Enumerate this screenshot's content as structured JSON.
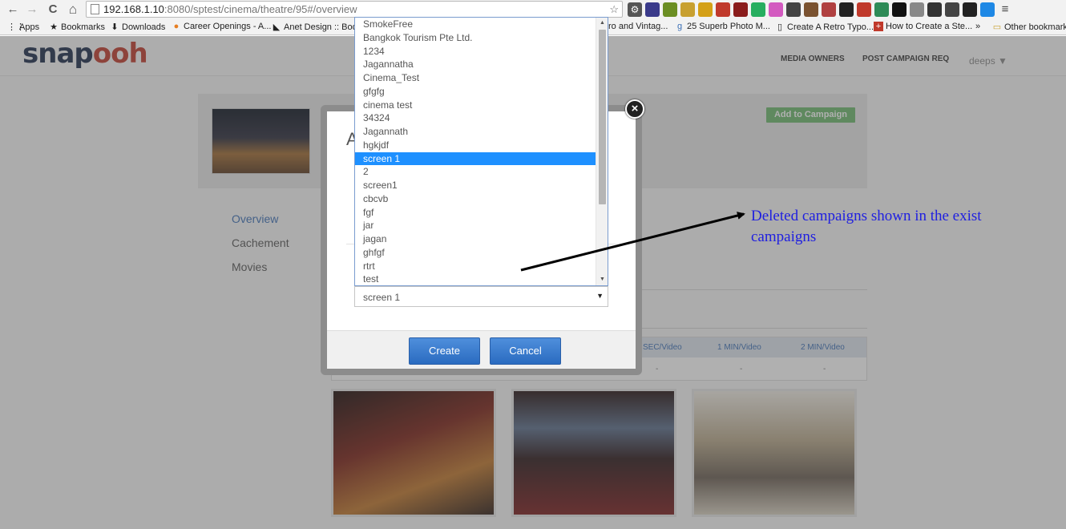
{
  "browser": {
    "url_host": "192.168.1.10",
    "url_rest": ":8080/sptest/cinema/theatre/95#/overview",
    "nav": {
      "back_icon": "←",
      "forward_icon": "→",
      "reload_icon": "C",
      "home_icon": "⌂"
    },
    "bookmarks": [
      {
        "label": "Apps",
        "icon": "apps-icon"
      },
      {
        "label": "Bookmarks",
        "icon": "star-icon"
      },
      {
        "label": "Downloads",
        "icon": "download-icon"
      },
      {
        "label": "Career Openings - A...",
        "icon": "page-icon"
      },
      {
        "label": "Anet Design :: Body",
        "icon": "page-icon"
      },
      {
        "label": "ro and Vintag...",
        "icon": "page-icon"
      },
      {
        "label": "25 Superb Photo M...",
        "icon": "page-icon"
      },
      {
        "label": "Create A Retro Typo...",
        "icon": "page-icon"
      },
      {
        "label": "How to Create a Ste...",
        "icon": "page-icon"
      },
      {
        "label": "»",
        "icon": ""
      },
      {
        "label": "Other bookmarks",
        "icon": "folder-icon"
      }
    ]
  },
  "site": {
    "logo": {
      "main": "snap",
      "accent": "ooh"
    },
    "nav": {
      "media_owners": "MEDIA OWNERS",
      "post_campaign": "POST CAMPAIGN REQ"
    },
    "user": "deeps ▼",
    "add_to_campaign": "Add to Campaign",
    "side_nav": {
      "overview": "Overview",
      "cachement": "Cachement",
      "movies": "Movies"
    },
    "rates": {
      "headers": [
        "SEC/Video",
        "1 MIN/Video",
        "2 MIN/Video"
      ],
      "values": [
        "-",
        "-",
        "-"
      ]
    }
  },
  "modal": {
    "title": "A",
    "select": {
      "selected": "screen 1",
      "options": [
        "SmokeFree",
        "Bangkok Tourism Pte Ltd.",
        "1234",
        "Jagannatha",
        "Cinema_Test",
        "gfgfg",
        "cinema test",
        "34324",
        "Jagannath",
        "hgkjdf",
        "screen 1",
        "2",
        "screen1",
        "cbcvb",
        "fgf",
        "jar",
        "jagan",
        "ghfgf",
        "rtrt",
        "test"
      ],
      "selected_index": 10
    },
    "create_label": "Create",
    "cancel_label": "Cancel",
    "close_glyph": "×"
  },
  "annotation": {
    "text": "Deleted campaigns shown in the exist campaigns",
    "color": "#2020e0"
  }
}
